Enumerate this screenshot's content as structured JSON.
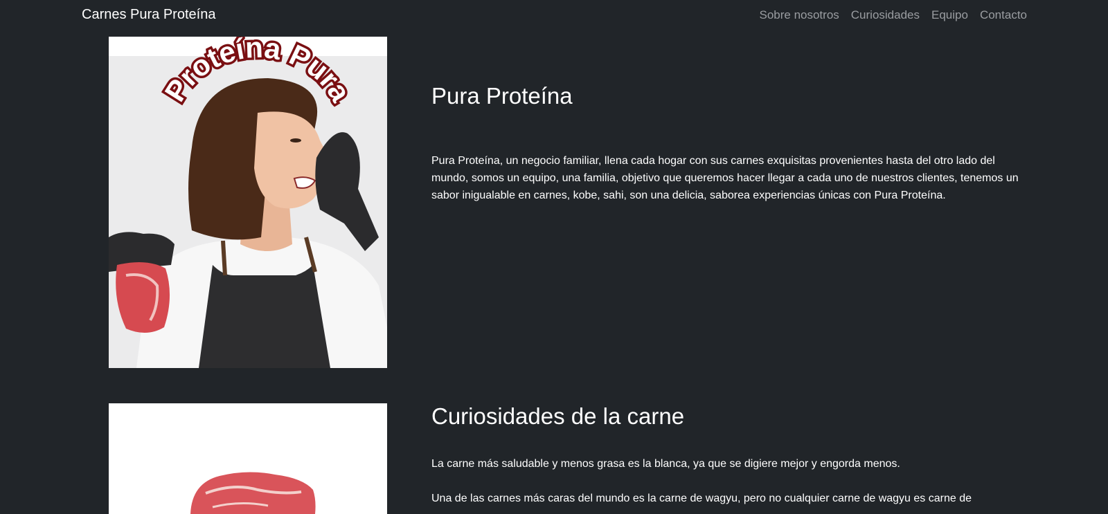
{
  "navbar": {
    "brand": "Carnes Pura Proteína",
    "links": [
      "Sobre nosotros",
      "Curiosidades",
      "Equipo",
      "Contacto"
    ]
  },
  "about": {
    "image_text": "Proteína Pura",
    "title": "Pura Proteína",
    "text": "Pura Proteína, un negocio familiar, llena cada hogar con sus carnes exquisitas provenientes hasta del otro lado del mundo, somos un equipo, una familia, objetivo que queremos hacer llegar a cada uno de nuestros clientes, tenemos un sabor inigualable en carnes, kobe, sahi, son una delicia, saborea experiencias únicas con Pura Proteína."
  },
  "curiosidades": {
    "title": "Curiosidades de la carne",
    "p1": "La carne más saludable y menos grasa es la blanca, ya que se digiere mejor y engorda menos.",
    "p2": "Una de las carnes más caras del mundo es la carne de wagyu, pero no cualquier carne de wagyu es carne de"
  },
  "colors": {
    "background": "#212529",
    "nav_link": "#9a9da1",
    "text": "#ffffff"
  }
}
